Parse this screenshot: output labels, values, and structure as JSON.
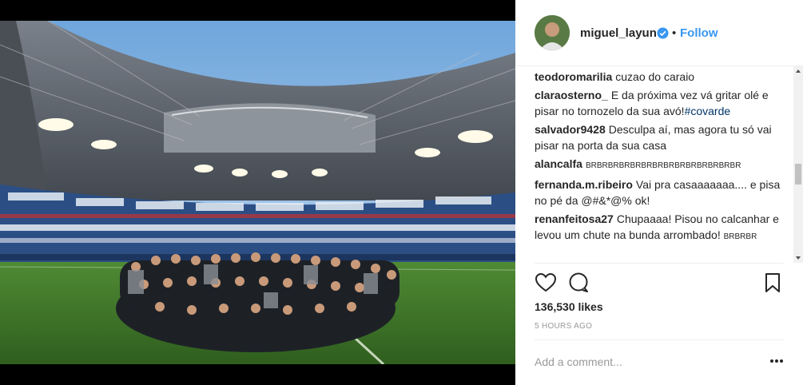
{
  "post": {
    "username": "miguel_layun",
    "dot": "•",
    "follow_label": "Follow",
    "comments": [
      {
        "user": "teodoromarilia",
        "text": "cuzao do caraio"
      },
      {
        "user": "claraosterno_",
        "text": "E da próxima vez vá gritar olé e pisar no tornozelo da sua avó!",
        "hashtag": "#covarde"
      },
      {
        "user": "salvador9428",
        "text": "Desculpa aí, mas agora tu só vai pisar na porta da sua casa"
      },
      {
        "user": "alancalfa",
        "text": "BRBRBRBRBRBRBRBRBRBRBRBRBRBR",
        "small": true
      },
      {
        "user": "fernanda.m.ribeiro",
        "text": "Vai pra casaaaaaaa.... e pisa no pé da @#&*@% ok!"
      },
      {
        "user": "renanfeitosa27",
        "text": "Chupaaaa! Pisou no calcanhar e levou um chute na bunda arrombado!",
        "tail": "BRBRBR"
      }
    ],
    "likes": "136,530 likes",
    "time": "5 HOURS AGO",
    "add_comment_placeholder": "Add a comment...",
    "icons": [
      "heart-icon",
      "comment-icon",
      "bookmark-icon",
      "verified-icon",
      "more-options-icon"
    ],
    "colors": {
      "link": "#3897f0",
      "hashtag": "#003569",
      "text": "#262626",
      "muted": "#999999"
    }
  }
}
